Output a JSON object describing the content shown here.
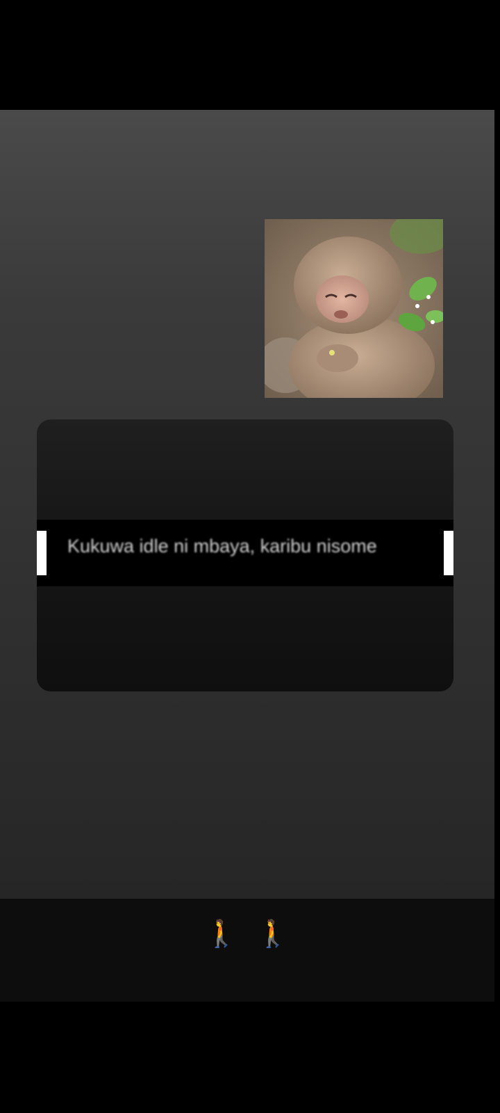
{
  "story": {
    "photo_subject": "baby-monkey-photo",
    "caption": "Kukuwa idle ni mbaya, karibu nisome"
  },
  "footer": {
    "emoji": [
      "🚶",
      "🚶"
    ]
  },
  "colors": {
    "background_top": "#4a4a4a",
    "background_bottom": "#262626",
    "card": "#151515",
    "caption_band": "#000000",
    "caption_text": "#cfcfcf"
  }
}
